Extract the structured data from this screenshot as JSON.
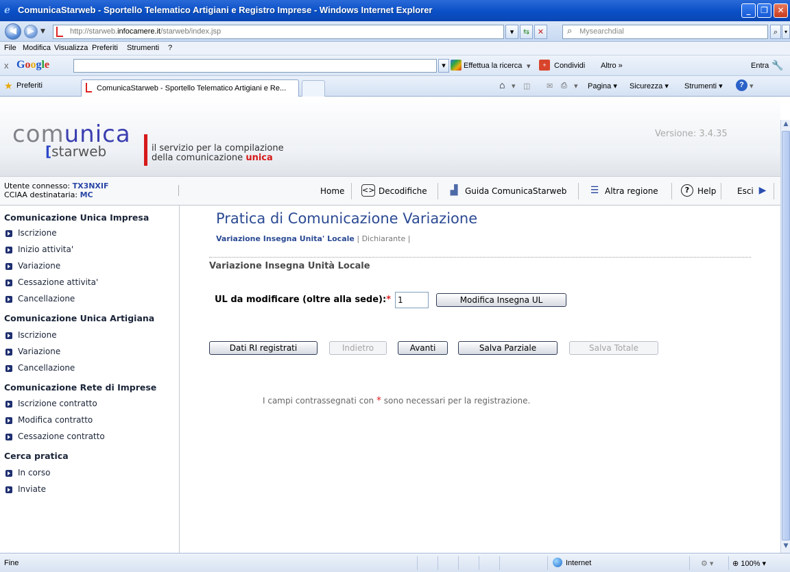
{
  "window": {
    "title": "ComunicaStarweb - Sportello Telematico Artigiani e Registro Imprese - Windows Internet Explorer",
    "min": "_",
    "max": "❐",
    "close": "✕"
  },
  "address": {
    "url_prefix": "http://starweb.",
    "url_domain": "infocamere.it",
    "url_path": "/starweb/index.jsp",
    "search_placeholder": "Mysearchdial"
  },
  "menu": [
    "File",
    "Modifica",
    "Visualizza",
    "Preferiti",
    "Strumenti",
    "?"
  ],
  "google_toolbar": {
    "close": "x",
    "logo": "Google",
    "search_label": "Effettua la ricerca",
    "share_label": "Condividi",
    "more_label": "Altro »",
    "signin_label": "Entra"
  },
  "favorites_bar": {
    "favorites_label": "Preferiti",
    "tab_label": "ComunicaStarweb - Sportello Telematico Artigiani e Re...",
    "page_label": "Pagina",
    "safety_label": "Sicurezza",
    "tools_label": "Strumenti"
  },
  "site": {
    "logo_word_pre": "com",
    "logo_word_accent": "unica",
    "logo_sub_bracket": "[",
    "logo_sub": "starweb",
    "tagline_line1": "il servizio per la compilazione",
    "tagline_line2_pre": "della comunicazione ",
    "tagline_line2_accent": "unica",
    "version": "Versione: 3.4.35"
  },
  "user": {
    "connected_label": "Utente connesso: ",
    "connected_value": "TX3NXIF",
    "cciaa_label": "CCIAA destinataria: ",
    "cciaa_value": "MC"
  },
  "nav": {
    "home": "Home",
    "decodifiche": "Decodifiche",
    "guida": "Guida ComunicaStarweb",
    "altra_regione": "Altra regione",
    "help": "Help",
    "esci": "Esci"
  },
  "sidebar": {
    "sections": [
      {
        "title": "Comunicazione Unica Impresa",
        "items": [
          "Iscrizione",
          "Inizio attivita'",
          "Variazione",
          "Cessazione attivita'",
          "Cancellazione"
        ]
      },
      {
        "title": "Comunicazione Unica Artigiana",
        "items": [
          "Iscrizione",
          "Variazione",
          "Cancellazione"
        ]
      },
      {
        "title": "Comunicazione Rete di Imprese",
        "items": [
          "Iscrizione contratto",
          "Modifica contratto",
          "Cessazione contratto"
        ]
      },
      {
        "title": "Cerca pratica",
        "items": [
          "In corso",
          "Inviate"
        ]
      }
    ]
  },
  "main": {
    "title": "Pratica di Comunicazione Variazione",
    "crumb_active": "Variazione Insegna Unita' Locale",
    "crumb_sep1": " | ",
    "crumb_other": "Dichiarante",
    "crumb_sep2": " |",
    "section_title": "Variazione Insegna Unità Locale",
    "ul_label": "UL da modificare (oltre alla sede):",
    "required_mark": "*",
    "ul_value": "1",
    "modifica_btn": "Modifica Insegna UL",
    "buttons": {
      "dati": "Dati RI registrati",
      "indietro": "Indietro",
      "avanti": "Avanti",
      "salva_parziale": "Salva Parziale",
      "salva_totale": "Salva Totale"
    },
    "note_pre": "I campi contrassegnati con ",
    "note_post": " sono necessari per la registrazione."
  },
  "status": {
    "left": "Fine",
    "zone": "Internet",
    "zoom": "100%"
  }
}
